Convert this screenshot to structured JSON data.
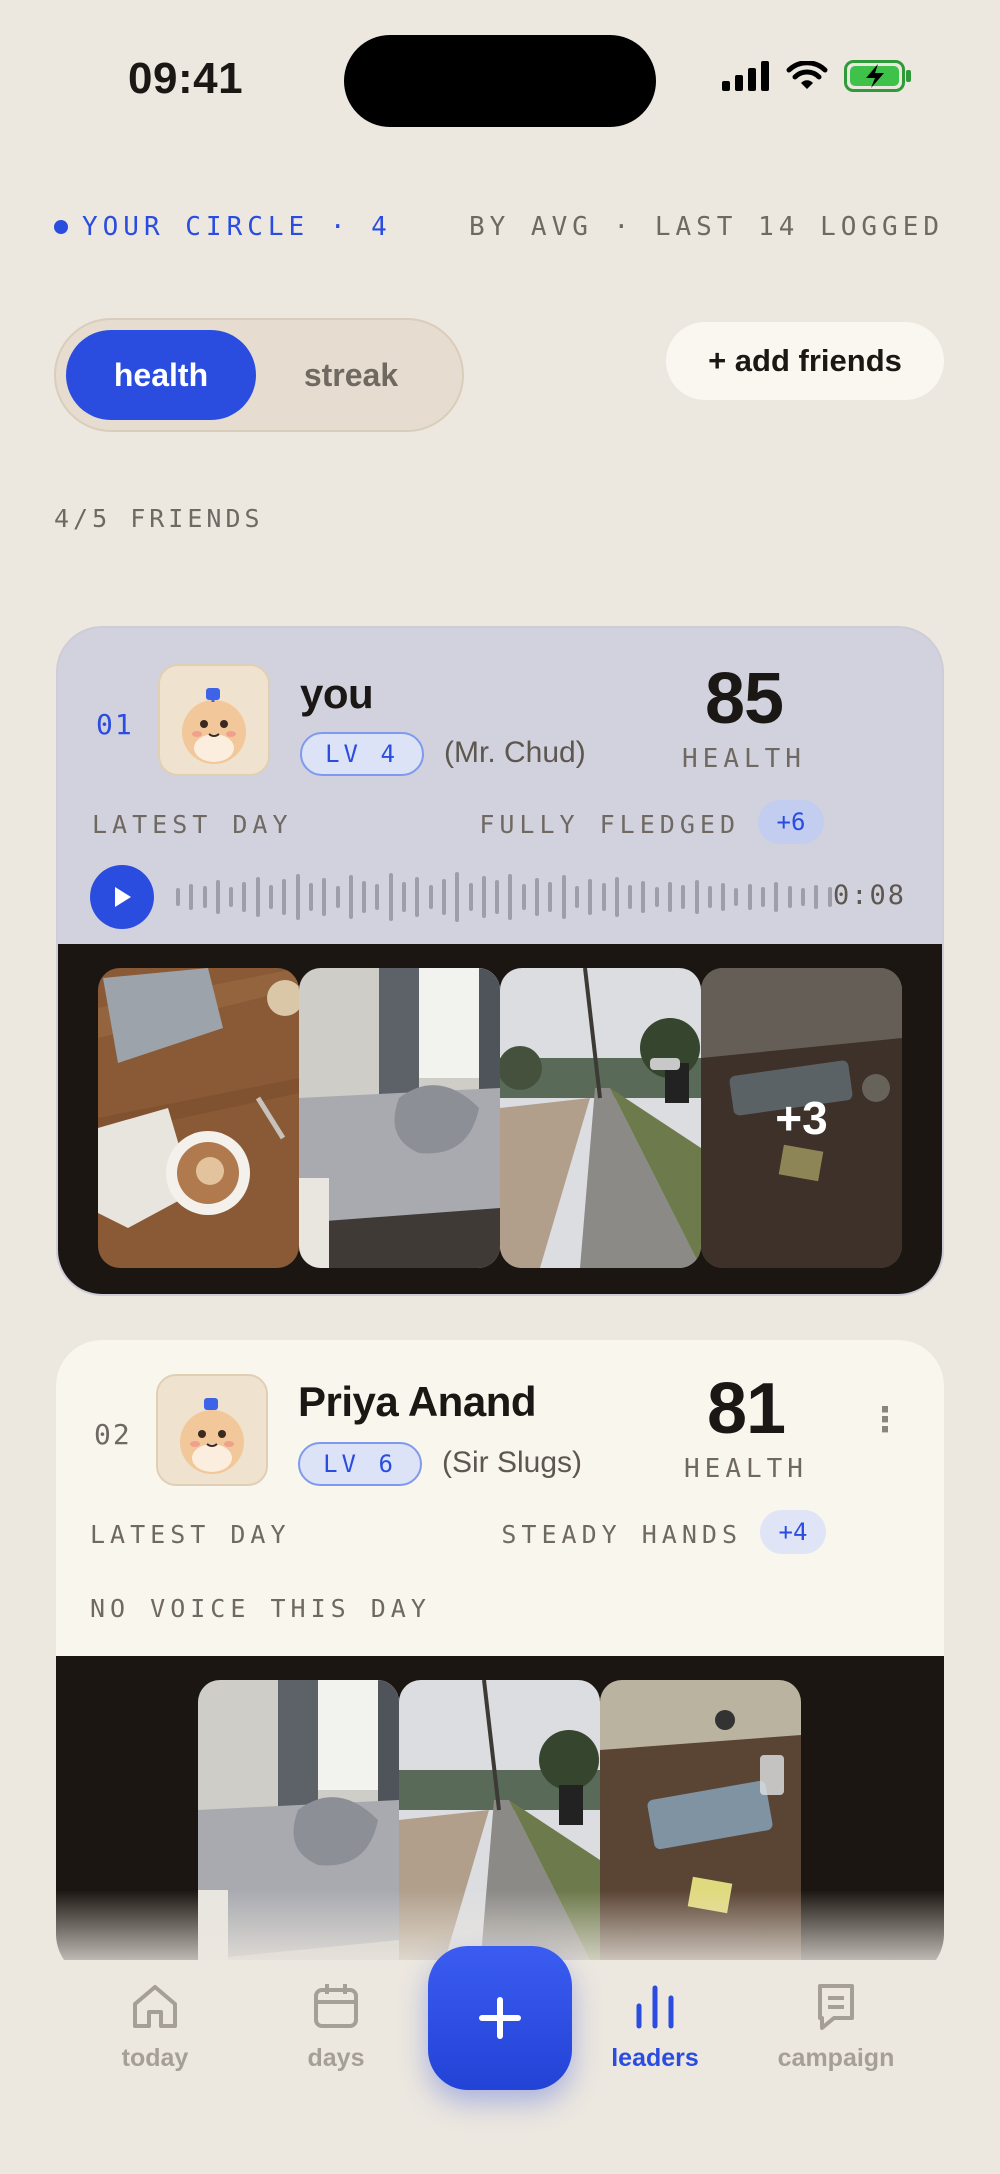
{
  "status_bar": {
    "time": "09:41"
  },
  "circle": {
    "label": "YOUR CIRCLE · 4",
    "sort": "BY AVG · LAST 14 LOGGED"
  },
  "toggle": {
    "health": "health",
    "streak": "streak",
    "selected": "health"
  },
  "add_friends_label": "+ add friends",
  "friends_count": "4/5 FRIENDS",
  "cards": [
    {
      "rank": "01",
      "name": "you",
      "level": "LV 4",
      "nickname": "(Mr. Chud)",
      "score": "85",
      "score_label": "HEALTH",
      "latest_label": "LATEST DAY",
      "badge": "FULLY FLEDGED",
      "badge_delta": "+6",
      "voice_duration": "0:08",
      "extra_photos": "+3"
    },
    {
      "rank": "02",
      "name": "Priya Anand",
      "level": "LV 6",
      "nickname": "(Sir Slugs)",
      "score": "81",
      "score_label": "HEALTH",
      "latest_label": "LATEST DAY",
      "badge": "STEADY HANDS",
      "badge_delta": "+4",
      "no_voice": "NO VOICE THIS DAY"
    }
  ],
  "nav": {
    "today": "today",
    "days": "days",
    "leaders": "leaders",
    "campaign": "campaign",
    "active": "leaders"
  },
  "colors": {
    "accent": "#2a4de0",
    "background": "#ece7df",
    "card_you": "#d2d2de",
    "card_other": "#f9f6ee"
  },
  "icons": [
    "signal-icon",
    "wifi-icon",
    "battery-icon",
    "play-icon",
    "more-icon",
    "home-icon",
    "calendar-icon",
    "plus-icon",
    "bar-chart-icon",
    "flag-icon"
  ]
}
